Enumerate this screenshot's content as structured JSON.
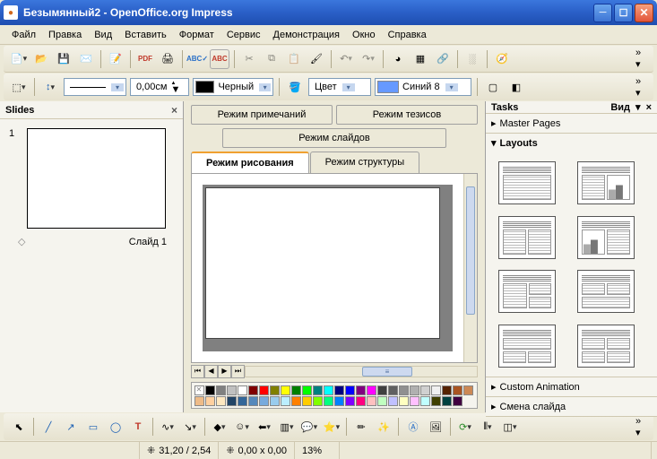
{
  "window": {
    "title": "Безымянный2 - OpenOffice.org Impress"
  },
  "menu": {
    "items": [
      "Файл",
      "Правка",
      "Вид",
      "Вставить",
      "Формат",
      "Сервис",
      "Демонстрация",
      "Окно",
      "Справка"
    ]
  },
  "formatBar": {
    "lineWidth": "0,00см",
    "lineSwatch": "#000000",
    "lineColorName": "Черный",
    "fillMode": "Цвет",
    "fillSwatch": "#6699ff",
    "fillColorName": "Синий 8"
  },
  "slidesPanel": {
    "title": "Slides",
    "slideNumber": "1",
    "slideLabel": "Слайд 1"
  },
  "centerPanel": {
    "tabNotes": "Режим примечаний",
    "tabAbstract": "Режим тезисов",
    "tabSlides": "Режим слайдов",
    "modeDrawing": "Режим рисования",
    "modeOutline": "Режим структуры"
  },
  "tasksPanel": {
    "title": "Tasks",
    "viewLabel": "Вид",
    "sectionMaster": "Master Pages",
    "sectionLayouts": "Layouts",
    "sectionCustomAnim": "Custom Animation",
    "sectionTransition": "Смена слайда"
  },
  "status": {
    "pos": "31,20 / 2,54",
    "size": "0,00 x 0,00",
    "zoom": "13%"
  },
  "palette": [
    "#000000",
    "#808080",
    "#c0c0c0",
    "#ffffff",
    "#800000",
    "#ff0000",
    "#808000",
    "#ffff00",
    "#008000",
    "#00ff00",
    "#008080",
    "#00ffff",
    "#000080",
    "#0000ff",
    "#800080",
    "#ff00ff",
    "#404040",
    "#606060",
    "#909090",
    "#b0b0b0",
    "#d0d0d0",
    "#f0f0f0",
    "#552200",
    "#aa5522",
    "#cc8855",
    "#eebb88",
    "#ffd0a0",
    "#ffe8c0",
    "#224466",
    "#336699",
    "#5588bb",
    "#77aadd",
    "#99ccee",
    "#bbeeff",
    "#ff8000",
    "#ffcc00",
    "#80ff00",
    "#00ff80",
    "#0080ff",
    "#8000ff",
    "#ff0080",
    "#ffc0c0",
    "#c0ffc0",
    "#c0c0ff",
    "#ffffC0",
    "#ffc0ff",
    "#c0ffff",
    "#404000",
    "#004040",
    "#400040"
  ]
}
